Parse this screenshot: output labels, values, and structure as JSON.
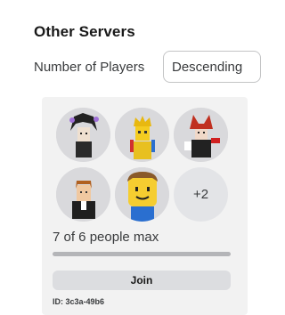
{
  "section": {
    "title": "Other Servers"
  },
  "filter": {
    "label": "Number of Players",
    "selected": "Descending"
  },
  "server": {
    "avatars": [
      {
        "icon": "dark-hair-avatar-icon"
      },
      {
        "icon": "gold-crown-avatar-icon"
      },
      {
        "icon": "red-horned-avatar-icon"
      },
      {
        "icon": "suit-avatar-icon"
      },
      {
        "icon": "classic-noob-avatar-icon"
      }
    ],
    "more_players": "+2",
    "player_count_text": "7 of 6 people max",
    "fill_fraction": 1.0,
    "join_label": "Join",
    "id_text": "ID: 3c3a-49b6"
  },
  "colors": {
    "card_bg": "#f2f2f2",
    "join_bg": "#dcdde0",
    "text": "#393b3d"
  }
}
